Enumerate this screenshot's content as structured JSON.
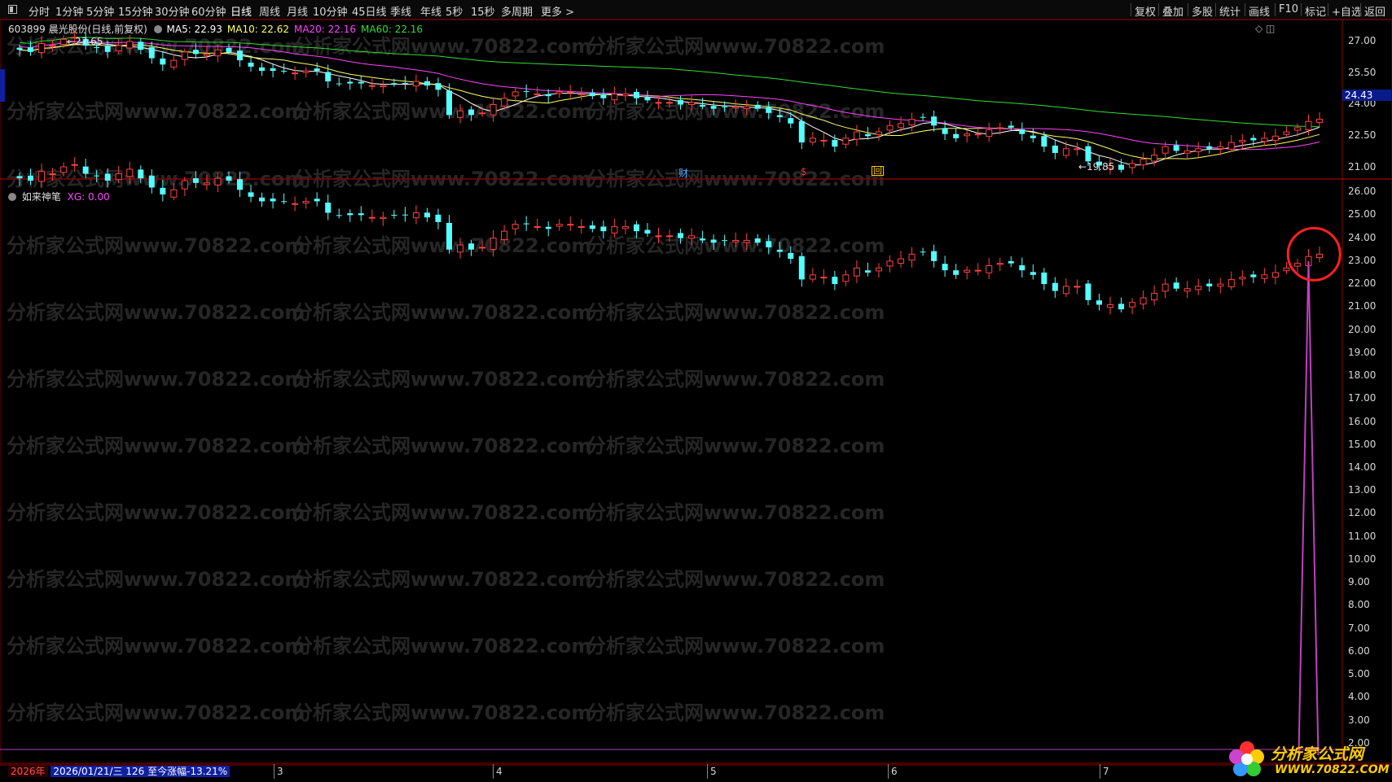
{
  "toolbar": {
    "periods": [
      "分时",
      "1分钟",
      "5分钟",
      "15分钟",
      "30分钟",
      "60分钟",
      "日线",
      "周线",
      "月线",
      "10分钟",
      "45日线",
      "季线",
      "年线",
      "5秒",
      "15秒",
      "多周期",
      "更多 >"
    ],
    "right_tools": [
      "复权",
      "叠加",
      "多股",
      "统计",
      "画线",
      "F10",
      "标记",
      "+自选",
      "返回"
    ]
  },
  "main_panel": {
    "stock_code": "603899",
    "stock_name": "晨光股份",
    "chart_mode": "(日线,前复权)",
    "ma": [
      {
        "label": "MA5: 22.93",
        "color": "#ffffff"
      },
      {
        "label": "MA10: 22.62",
        "color": "#ffff66"
      },
      {
        "label": "MA20: 22.16",
        "color": "#ff44ff"
      },
      {
        "label": "MA60: 22.16",
        "color": "#33dd33"
      }
    ],
    "high_label": "27.65",
    "low_label": "19.85",
    "current_price": "24.43",
    "y_ticks": [
      "27.00",
      "25.50",
      "24.00",
      "22.50",
      "21.00"
    ],
    "event_markers": [
      {
        "text": "财",
        "color": "#4aa3ff"
      },
      {
        "text": "$",
        "color": "#ff3030"
      },
      {
        "text": "回",
        "color": "#ffcc00"
      }
    ]
  },
  "indicator_panel": {
    "name": "如来神笔",
    "xg_label": "XG: 0.00",
    "y_ticks": [
      "26.00",
      "25.00",
      "24.00",
      "23.00",
      "22.00",
      "21.00",
      "20.00",
      "19.00",
      "18.00",
      "17.00",
      "16.00",
      "15.00",
      "14.00",
      "13.00",
      "12.00",
      "11.00",
      "10.00",
      "9.00",
      "8.00",
      "7.00",
      "6.00",
      "5.00",
      "4.00",
      "3.00",
      "2.00"
    ]
  },
  "x_axis": {
    "year": "2026年",
    "range_info": "2026/01/21/三 126 至今涨幅-13.21%",
    "months": [
      "3",
      "4",
      "5",
      "6",
      "7"
    ]
  },
  "watermark": {
    "text": "分析家公式网www.70822.com"
  },
  "logo": {
    "title": "分析家公式网",
    "url": "WWW.70822.COM"
  },
  "colors": {
    "up": "#ff4040",
    "down": "#54ffff",
    "ma5": "#ffffff",
    "ma10": "#ffff66",
    "ma20": "#ff44ff",
    "ma60": "#33dd33",
    "signal": "#c040c0",
    "circle": "#ff2020"
  },
  "chart_data": {
    "type": "candlestick",
    "title": "603899 晨光股份 (日线,前复权)",
    "ylim_main": [
      20.5,
      28.0
    ],
    "ylim_indicator": [
      1.5,
      26.5
    ],
    "signal_value_peak": 23.0,
    "signal_value_base": 1.5,
    "closes": [
      26.6,
      26.5,
      26.9,
      26.8,
      27.1,
      27.2,
      26.8,
      26.7,
      26.5,
      26.8,
      27.0,
      26.6,
      26.2,
      25.9,
      26.1,
      26.5,
      26.4,
      26.4,
      26.6,
      26.5,
      26.1,
      25.8,
      25.6,
      25.6,
      25.6,
      25.5,
      25.6,
      25.6,
      25.1,
      25.0,
      25.0,
      25.0,
      24.9,
      24.9,
      25.0,
      25.0,
      25.1,
      24.9,
      24.7,
      23.5,
      23.7,
      23.5,
      23.6,
      24.0,
      24.3,
      24.6,
      24.6,
      24.5,
      24.4,
      24.6,
      24.6,
      24.5,
      24.4,
      24.3,
      24.5,
      24.5,
      24.3,
      24.2,
      24.1,
      24.1,
      24.0,
      24.1,
      23.9,
      23.8,
      23.9,
      23.9,
      23.9,
      23.8,
      23.6,
      23.4,
      23.1,
      22.2,
      22.4,
      22.3,
      22.0,
      22.4,
      22.7,
      22.5,
      22.7,
      23.0,
      23.1,
      23.3,
      23.4,
      23.0,
      22.6,
      22.4,
      22.6,
      22.6,
      22.8,
      22.9,
      22.9,
      22.6,
      22.4,
      22.0,
      21.7,
      21.9,
      21.9,
      21.3,
      21.1,
      21.1,
      20.9,
      21.2,
      21.4,
      21.6,
      22.0,
      21.8,
      21.8,
      21.9,
      21.9,
      22.0,
      22.2,
      22.3,
      22.3,
      22.4,
      22.5,
      22.7,
      22.9,
      23.2,
      23.3
    ]
  }
}
